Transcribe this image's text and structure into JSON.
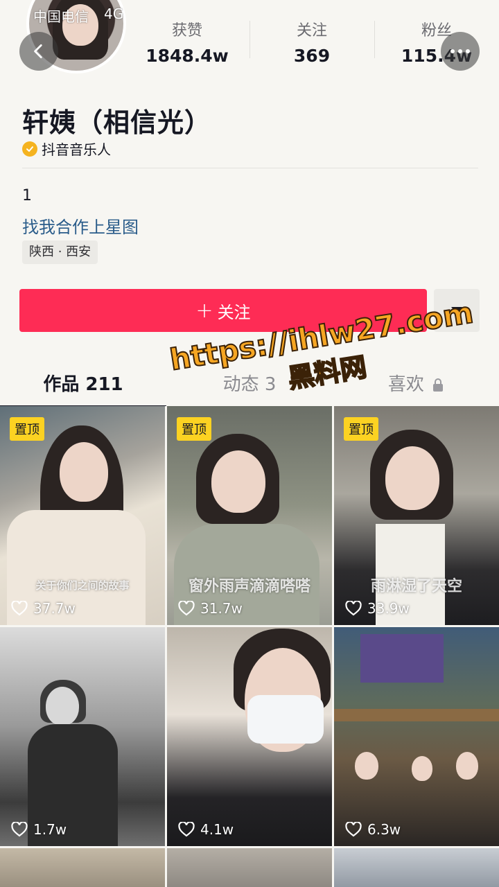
{
  "status_bar": {
    "carrier": "中国电信",
    "network": "4G"
  },
  "profile": {
    "name": "轩姨（相信光）",
    "verified_label": "抖音音乐人",
    "bio": "1",
    "link_text": "找我合作上星图",
    "location": "陕西 · 西安"
  },
  "stats": [
    {
      "label": "获赞",
      "value": "1848.4w"
    },
    {
      "label": "关注",
      "value": "369"
    },
    {
      "label": "粉丝",
      "value": "115.4w"
    }
  ],
  "actions": {
    "follow_label": "关注",
    "follow_plus": "+"
  },
  "tabs": [
    {
      "label": "作品 211"
    },
    {
      "label": "动态 3"
    },
    {
      "label": "喜欢"
    }
  ],
  "watermark": {
    "line1": "https://ihlw27.com",
    "line2": "黑料网"
  },
  "videos": [
    {
      "pinned": true,
      "pin_label": "置顶",
      "caption": "关于你们之间的故事",
      "likes": "37.7w"
    },
    {
      "pinned": true,
      "pin_label": "置顶",
      "caption": "窗外雨声滴滴嗒嗒",
      "likes": "31.7w"
    },
    {
      "pinned": true,
      "pin_label": "置顶",
      "caption": "雨淋湿了天空",
      "likes": "33.9w"
    },
    {
      "pinned": false,
      "caption": "",
      "likes": "1.7w"
    },
    {
      "pinned": false,
      "caption": "",
      "likes": "4.1w"
    },
    {
      "pinned": false,
      "caption": "",
      "likes": "6.3w"
    }
  ],
  "icons": {
    "back": "chevron-left-icon",
    "more": "more-dots-icon",
    "verified": "verified-check-icon",
    "dropdown": "caret-down-icon",
    "lock": "lock-icon",
    "like": "heart-outline-icon"
  },
  "colors": {
    "follow_button": "#fe2c55",
    "verified_badge": "#f5b31f",
    "pin_badge": "#fcd222",
    "link": "#2a5c8a"
  }
}
